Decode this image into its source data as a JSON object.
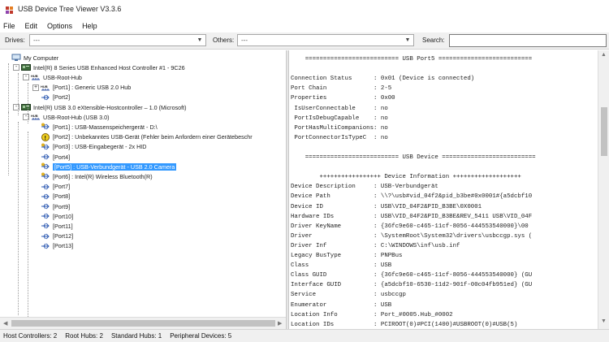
{
  "window": {
    "title": "USB Device Tree Viewer V3.3.6"
  },
  "menu": [
    "File",
    "Edit",
    "Options",
    "Help"
  ],
  "toolbar": {
    "drives_label": "Drives:",
    "drives_value": "---",
    "others_label": "Others:",
    "others_value": "---",
    "search_label": "Search:",
    "search_value": ""
  },
  "tree": [
    {
      "level": 0,
      "icon": "computer-icon",
      "text": "My Computer",
      "expander": ""
    },
    {
      "level": 1,
      "icon": "controller-icon",
      "text": "Intel(R) 8 Series USB Enhanced Host Controller #1 - 9C26",
      "expander": "-"
    },
    {
      "level": 2,
      "icon": "root-hub-icon",
      "text": "USB-Root-Hub",
      "expander": "-"
    },
    {
      "level": 3,
      "icon": "hub-icon",
      "text": "[Port1] : Generic USB 2.0 Hub",
      "expander": "+"
    },
    {
      "level": 3,
      "icon": "usb-port-icon",
      "text": "[Port2]",
      "expander": ""
    },
    {
      "level": 1,
      "icon": "controller-icon",
      "text": "Intel(R) USB 3.0 eXtensible-Hostcontroller – 1.0 (Microsoft)",
      "expander": "-"
    },
    {
      "level": 2,
      "icon": "root-hub-icon",
      "text": "USB-Root-Hub (USB 3.0)",
      "expander": "-"
    },
    {
      "level": 3,
      "icon": "usb-device-icon",
      "text": "[Port1] : USB-Massenspeichergerät - D:\\",
      "expander": ""
    },
    {
      "level": 3,
      "icon": "warning-device-icon",
      "text": "[Port2] : Unbekanntes USB-Gerät (Fehler beim Anfordern einer Gerätebeschr",
      "expander": ""
    },
    {
      "level": 3,
      "icon": "usb-device-icon",
      "text": "[Port3] : USB-Eingabegerät - 2x HID",
      "expander": ""
    },
    {
      "level": 3,
      "icon": "usb-port-icon",
      "text": "[Port4]",
      "expander": ""
    },
    {
      "level": 3,
      "icon": "usb-device-icon",
      "text": "[Port5] : USB-Verbundgerät - USB 2.0 Camera",
      "expander": "",
      "selected": true
    },
    {
      "level": 3,
      "icon": "usb-device-icon",
      "text": "[Port6] : Intel(R) Wireless Bluetooth(R)",
      "expander": ""
    },
    {
      "level": 3,
      "icon": "usb-port-icon",
      "text": "[Port7]",
      "expander": ""
    },
    {
      "level": 3,
      "icon": "usb-port-icon",
      "text": "[Port8]",
      "expander": ""
    },
    {
      "level": 3,
      "icon": "usb-port-icon",
      "text": "[Port9]",
      "expander": ""
    },
    {
      "level": 3,
      "icon": "usb-port-icon",
      "text": "[Port10]",
      "expander": ""
    },
    {
      "level": 3,
      "icon": "usb-port-icon",
      "text": "[Port11]",
      "expander": ""
    },
    {
      "level": 3,
      "icon": "usb-port-icon",
      "text": "[Port12]",
      "expander": ""
    },
    {
      "level": 3,
      "icon": "usb-port-icon",
      "text": "[Port13]",
      "expander": ""
    }
  ],
  "details": [
    "    ========================== USB Port5 ==========================",
    "",
    "Connection Status      : 0x01 (Device is connected)",
    "Port Chain             : 2-5",
    "Properties             : 0x00",
    " IsUserConnectable     : no",
    " PortIsDebugCapable    : no",
    " PortHasMultiCompanions: no",
    " PortConnectorIsTypeC  : no",
    "",
    "    ========================== USB Device ==========================",
    "",
    "        +++++++++++++++++ Device Information +++++++++++++++++++",
    "Device Description     : USB-Verbundgerät",
    "Device Path            : \\\\?\\usb#vid_04f2&pid_b3be#0x0001#{a5dcbf10",
    "Device ID              : USB\\VID_04F2&PID_B3BE\\0X0001",
    "Hardware IDs           : USB\\VID_04F2&PID_B3BE&REV_5411 USB\\VID_04F",
    "Driver KeyName         : {36fc9e60-c465-11cf-8056-444553540000}\\00",
    "Driver                 : \\SystemRoot\\System32\\drivers\\usbccgp.sys (",
    "Driver Inf             : C:\\WINDOWS\\inf\\usb.inf",
    "Legacy BusType         : PNPBus",
    "Class                  : USB",
    "Class GUID             : {36fc9e60-c465-11cf-8056-444553540000} (GU",
    "Interface GUID         : {a5dcbf10-6530-11d2-901f-00c04fb951ed} (GU",
    "Service                : usbccgp",
    "Enumerator             : USB",
    "Location Info          : Port_#0005.Hub_#0002",
    "Location IDs           : PCIROOT(0)#PCI(1400)#USBROOT(0)#USB(5)"
  ],
  "status": {
    "host_controllers": "Host Controllers: 2",
    "root_hubs": "Root Hubs: 2",
    "standard_hubs": "Standard Hubs: 1",
    "peripheral_devices": "Peripheral Devices: 5"
  },
  "colors": {
    "selection": "#3399ff",
    "controller": "#3d6b3a"
  }
}
